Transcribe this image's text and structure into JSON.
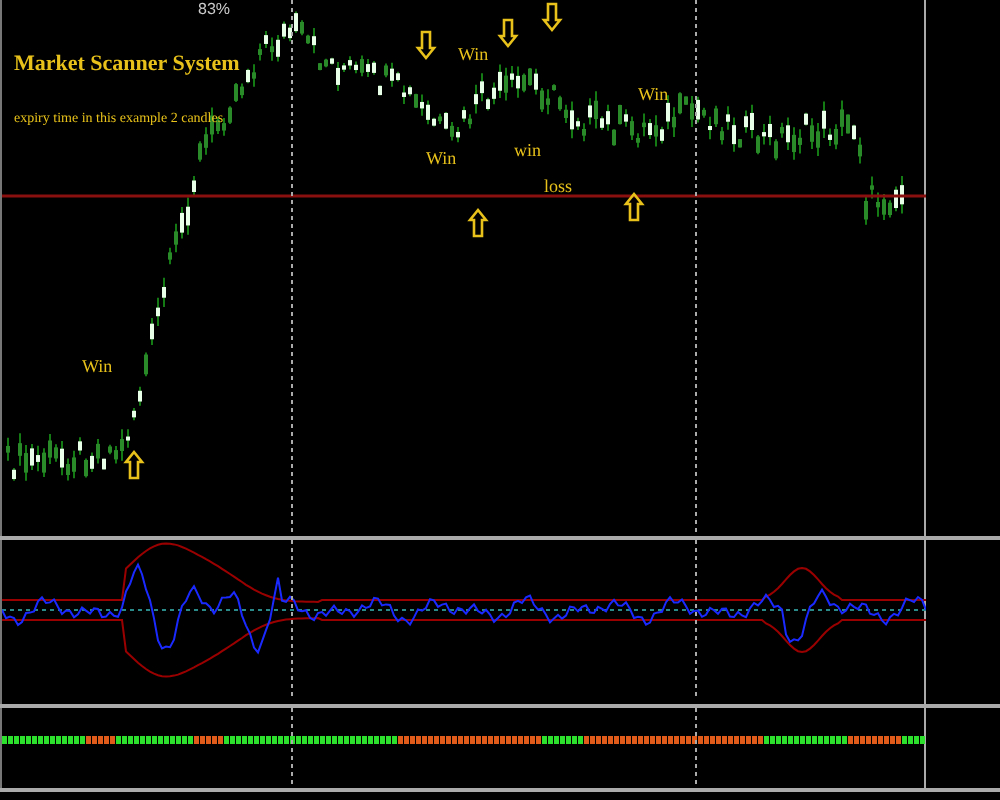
{
  "chart": {
    "zoom": "83%",
    "title": "Market Scanner System",
    "subtitle": "expiry time in this example 2 candles",
    "annotations": [
      {
        "kind": "label",
        "text": "Win"
      },
      {
        "kind": "label",
        "text": "Win"
      },
      {
        "kind": "label",
        "text": "Win"
      },
      {
        "kind": "label",
        "text": "win"
      },
      {
        "kind": "label",
        "text": "loss"
      },
      {
        "kind": "label",
        "text": "Win"
      },
      {
        "kind": "up"
      },
      {
        "kind": "down"
      },
      {
        "kind": "down"
      },
      {
        "kind": "down"
      },
      {
        "kind": "up"
      },
      {
        "kind": "up"
      }
    ]
  }
}
